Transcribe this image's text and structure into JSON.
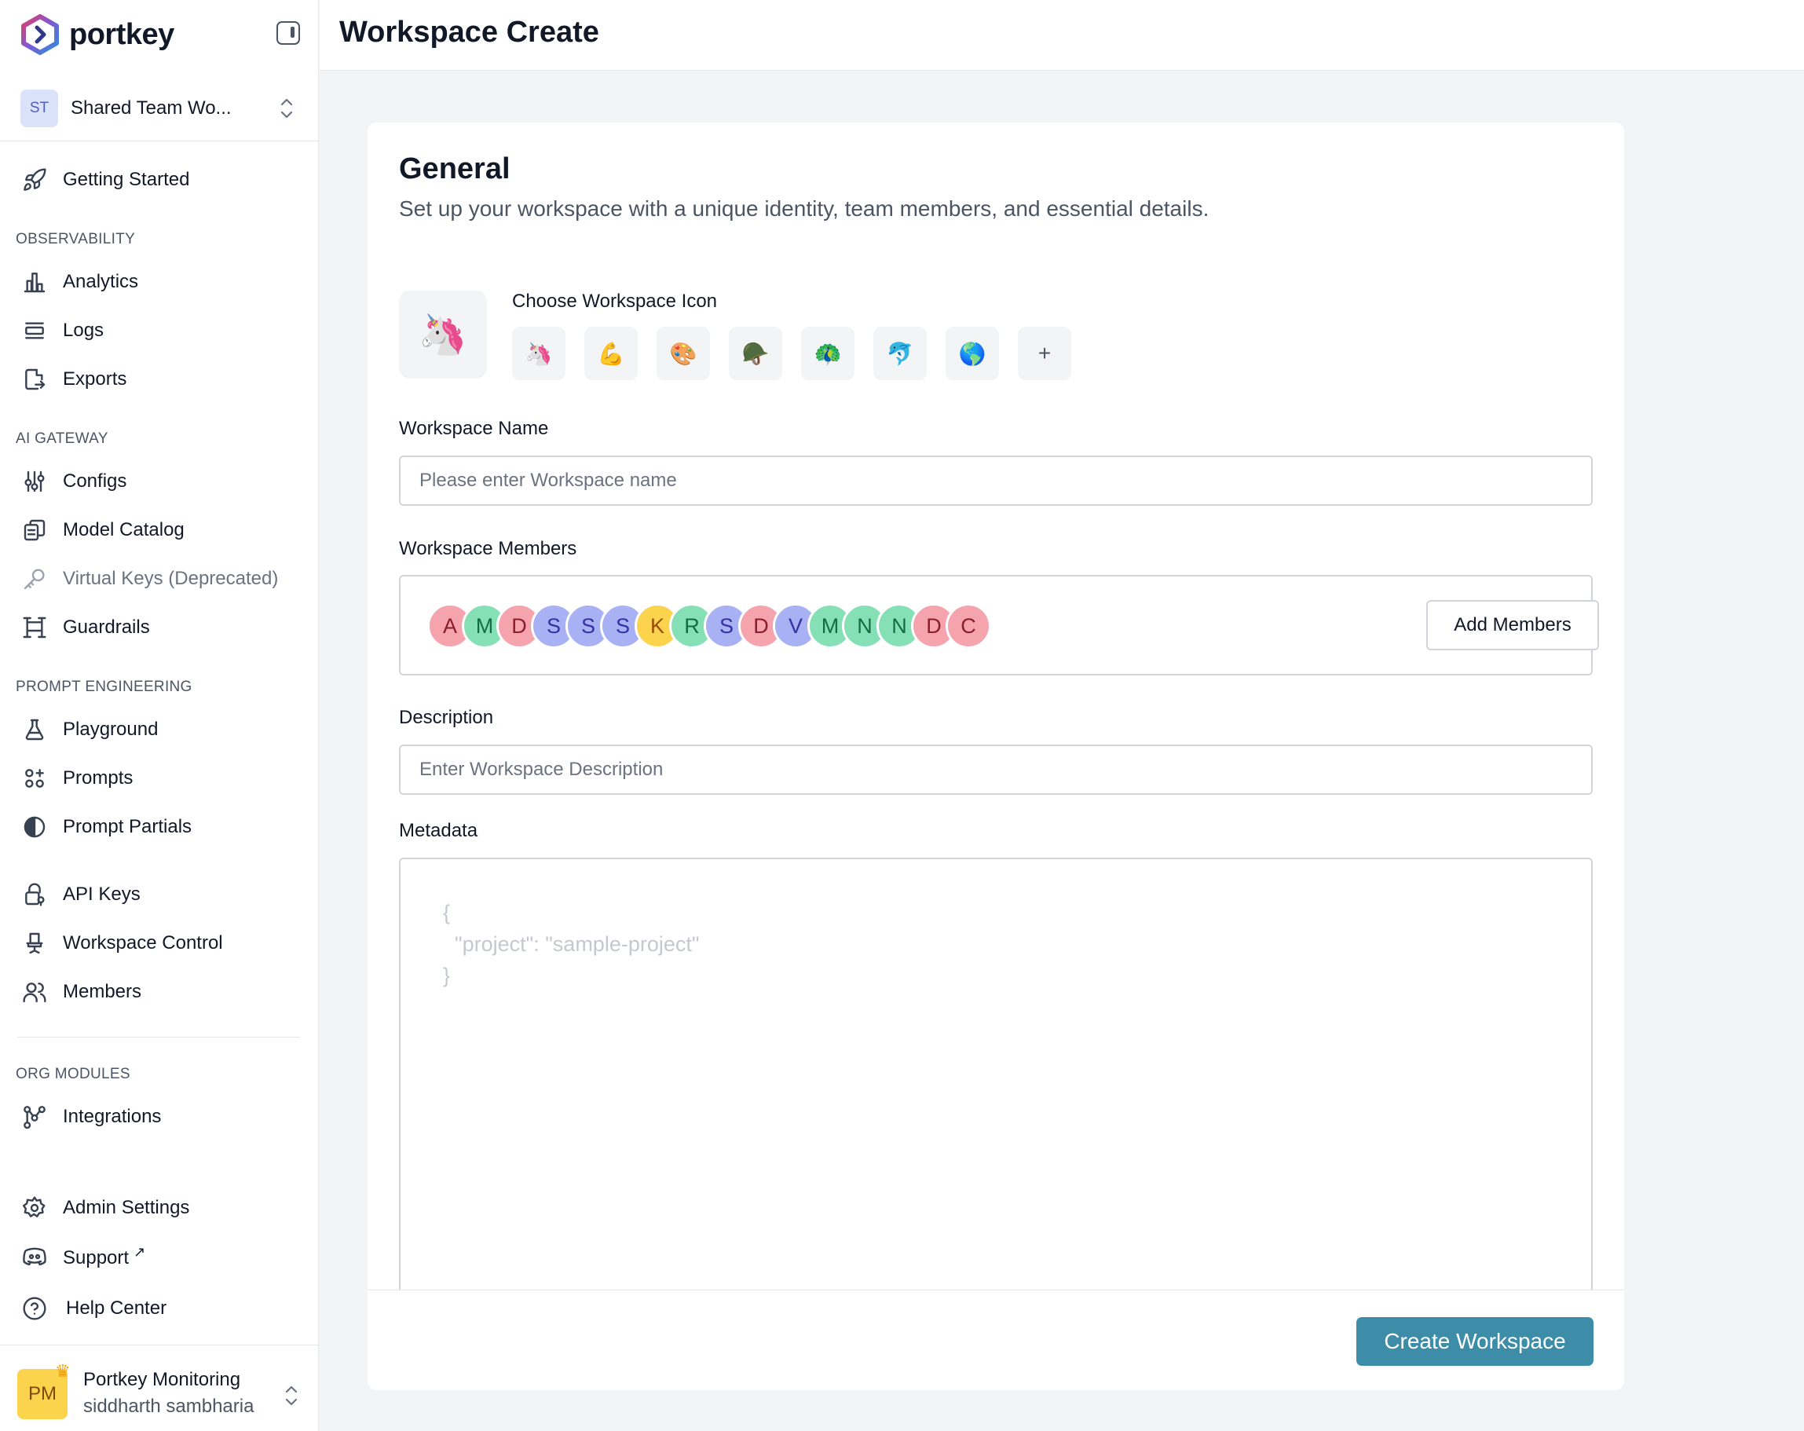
{
  "brand": {
    "name": "portkey"
  },
  "workspace_switcher": {
    "initials": "ST",
    "name": "Shared Team Wo..."
  },
  "sidebar": {
    "getting_started": "Getting Started",
    "sections": {
      "observability": "OBSERVABILITY",
      "ai_gateway": "AI GATEWAY",
      "prompt_engineering": "PROMPT ENGINEERING",
      "org_modules": "ORG MODULES"
    },
    "items": {
      "analytics": "Analytics",
      "logs": "Logs",
      "exports": "Exports",
      "configs": "Configs",
      "model_catalog": "Model Catalog",
      "virtual_keys": "Virtual Keys (Deprecated)",
      "guardrails": "Guardrails",
      "playground": "Playground",
      "prompts": "Prompts",
      "prompt_partials": "Prompt Partials",
      "api_keys": "API Keys",
      "workspace_control": "Workspace Control",
      "members": "Members",
      "integrations": "Integrations",
      "admin_settings": "Admin Settings",
      "support": "Support",
      "help_center": "Help Center"
    },
    "support_ext_icon": "↗"
  },
  "user": {
    "initials": "PM",
    "org": "Portkey Monitoring",
    "name": "siddharth sambharia",
    "crown_icon": "crown-icon"
  },
  "header": {
    "title": "Workspace Create"
  },
  "form": {
    "title": "General",
    "subtitle": "Set up your workspace with a unique identity, team members, and essential details.",
    "icon_label": "Choose Workspace Icon",
    "selected_icon": "🦄",
    "icon_options": [
      "🦄",
      "💪",
      "🎨",
      "🪖",
      "🦚",
      "🐬",
      "🌎",
      "+"
    ],
    "name_label": "Workspace Name",
    "name_placeholder": "Please enter Workspace name",
    "members_label": "Workspace Members",
    "members": [
      {
        "initial": "A",
        "color": "pink"
      },
      {
        "initial": "M",
        "color": "green"
      },
      {
        "initial": "D",
        "color": "pink"
      },
      {
        "initial": "S",
        "color": "blue"
      },
      {
        "initial": "S",
        "color": "blue"
      },
      {
        "initial": "S",
        "color": "blue"
      },
      {
        "initial": "K",
        "color": "yellow"
      },
      {
        "initial": "R",
        "color": "green"
      },
      {
        "initial": "S",
        "color": "blue"
      },
      {
        "initial": "D",
        "color": "pink"
      },
      {
        "initial": "V",
        "color": "blue"
      },
      {
        "initial": "M",
        "color": "green"
      },
      {
        "initial": "N",
        "color": "green"
      },
      {
        "initial": "N",
        "color": "green"
      },
      {
        "initial": "D",
        "color": "pink"
      },
      {
        "initial": "C",
        "color": "pink"
      }
    ],
    "add_members_label": "Add Members",
    "description_label": "Description",
    "description_placeholder": "Enter Workspace Description",
    "metadata_label": "Metadata",
    "metadata_placeholder": "{\n  \"project\": \"sample-project\"\n}",
    "submit_label": "Create Workspace"
  },
  "colors": {
    "accent": "#3d8ca8",
    "avatar_pink": "#f5a3ad",
    "avatar_green": "#86e0b5",
    "avatar_blue": "#a7b1f3",
    "avatar_yellow": "#fcd34d"
  }
}
